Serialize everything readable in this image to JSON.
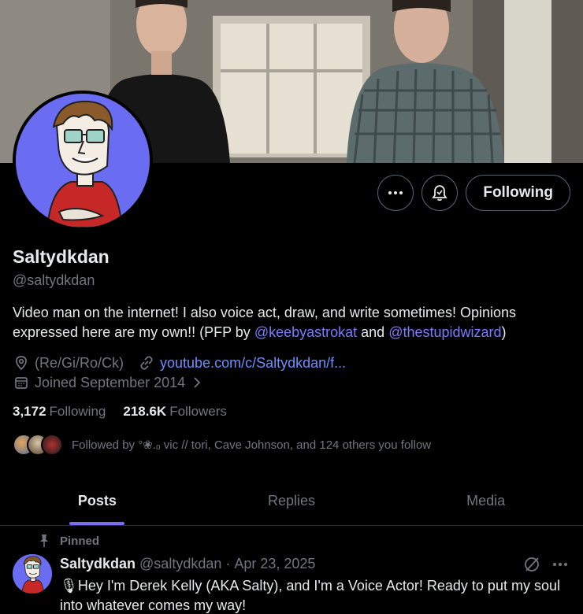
{
  "profile": {
    "name": "Saltydkdan",
    "handle": "@saltydkdan",
    "bio_text_1": "Video man on the internet! I also voice act, draw, and write sometimes! Opinions expressed here are my own!! (PFP by ",
    "bio_mention_1": "@keebyastrokat",
    "bio_text_2": " and ",
    "bio_mention_2": "@thestupidwizard",
    "bio_text_3": ")",
    "location": "(Re/Gi/Ro/Ck)",
    "website": "youtube.com/c/Saltydkdan/f...",
    "joined": "Joined September 2014",
    "following_count": "3,172",
    "following_label": "Following",
    "followers_count": "218.6K",
    "followers_label": "Followers",
    "followed_by": "Followed by °❀.ₒ vic // tori, Cave Johnson, and 124 others you follow"
  },
  "actions": {
    "more_icon": "more-icon",
    "notify_icon": "bell-icon",
    "follow_label": "Following"
  },
  "tabs": [
    {
      "label": "Posts",
      "active": true
    },
    {
      "label": "Replies",
      "active": false
    },
    {
      "label": "Media",
      "active": false
    }
  ],
  "post": {
    "pinned_label": "Pinned",
    "author": "Saltydkdan",
    "handle": "@saltydkdan",
    "separator": "·",
    "date": "Apr 23, 2025",
    "text": "🎙Hey I'm Derek Kelly (AKA Salty), and I'm a Voice Actor! Ready to put my soul into whatever comes my way!"
  },
  "colors": {
    "background": "#000000",
    "accent": "#7b6cf6",
    "link": "#7c7bff",
    "muted": "#71767b",
    "avatar_bg": "#6a6cf2"
  }
}
